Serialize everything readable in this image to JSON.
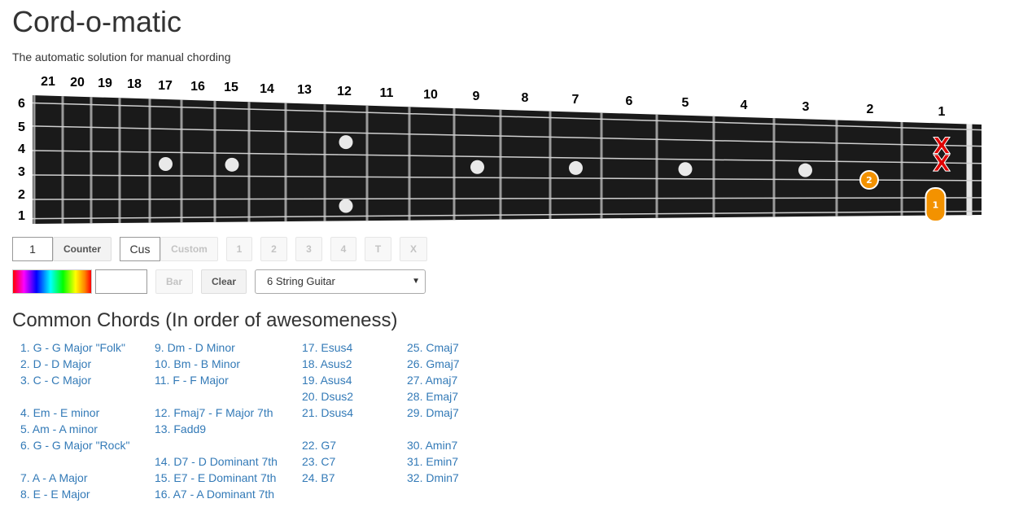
{
  "app": {
    "title": "Cord-o-matic",
    "tagline": "The automatic solution for manual chording"
  },
  "fretboard": {
    "fret_numbers": [
      "21",
      "20",
      "19",
      "18",
      "17",
      "16",
      "15",
      "14",
      "13",
      "12",
      "11",
      "10",
      "9",
      "8",
      "7",
      "6",
      "5",
      "4",
      "3",
      "2",
      "1"
    ],
    "string_numbers": [
      "6",
      "5",
      "4",
      "3",
      "2",
      "1"
    ],
    "markers": [
      {
        "type": "muted",
        "label": "X",
        "string": 5
      },
      {
        "type": "muted",
        "label": "X",
        "string": 4
      },
      {
        "type": "finger",
        "label": "2",
        "string": 3,
        "fret": 2
      },
      {
        "type": "finger",
        "label": "1",
        "string": 2,
        "fret": 1,
        "barre_strings": [
          1,
          2
        ]
      }
    ],
    "colors": {
      "board": "#1a1a1a",
      "fret": "#9a9a9a",
      "string": "#cfcfcf",
      "inlay": "#e9e9e9",
      "finger": "#f39200",
      "muted": "#e00000"
    }
  },
  "controls": {
    "counter_value": "1",
    "counter_label": "Counter",
    "custom_value": "Cus",
    "custom_label": "Custom",
    "finger_buttons": [
      "1",
      "2",
      "3",
      "4",
      "T",
      "X"
    ],
    "bar_label": "Bar",
    "clear_label": "Clear",
    "instrument_selected": "6 String Guitar"
  },
  "chords": {
    "heading": "Common Chords (In order of awesomeness)",
    "columns": [
      [
        "1. G - G Major \"Folk\"",
        "2. D - D Major",
        "3. C - C Major",
        "",
        "4. Em - E minor",
        "5. Am - A minor",
        "6. G - G Major \"Rock\"",
        "",
        "7. A - A Major",
        "8. E - E Major"
      ],
      [
        "9. Dm - D Minor",
        "10. Bm - B Minor",
        "11. F - F Major",
        "",
        "12. Fmaj7 - F Major 7th",
        "13. Fadd9",
        "",
        "14. D7 - D Dominant 7th",
        "15. E7 - E Dominant 7th",
        "16. A7 - A Dominant 7th"
      ],
      [
        "17. Esus4",
        "18. Asus2",
        "19. Asus4",
        "20. Dsus2",
        "21. Dsus4",
        "",
        "22. G7",
        "23. C7",
        "24. B7"
      ],
      [
        "25. Cmaj7",
        "26. Gmaj7",
        "27. Amaj7",
        "28. Emaj7",
        "29. Dmaj7",
        "",
        "30. Amin7",
        "31. Emin7",
        "32. Dmin7"
      ]
    ]
  }
}
